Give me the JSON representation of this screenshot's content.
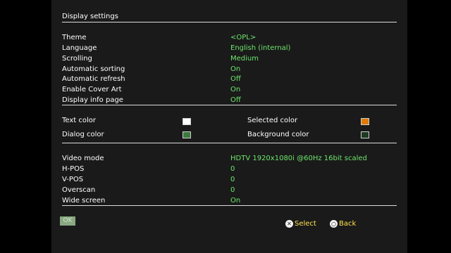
{
  "title": "Display settings",
  "general": {
    "items": [
      {
        "label": "Theme",
        "value": "<OPL>"
      },
      {
        "label": "Language",
        "value": "English (internal)"
      },
      {
        "label": "Scrolling",
        "value": "Medium"
      },
      {
        "label": "Automatic sorting",
        "value": "On"
      },
      {
        "label": "Automatic refresh",
        "value": "Off"
      },
      {
        "label": "Enable Cover Art",
        "value": "On"
      },
      {
        "label": "Display info page",
        "value": "Off"
      }
    ]
  },
  "colors": {
    "text_color": {
      "label": "Text color",
      "color": "#ffffff"
    },
    "dialog_color": {
      "label": "Dialog color",
      "color": "#3c7a3c"
    },
    "selected_color": {
      "label": "Selected color",
      "color": "#e07a00"
    },
    "background_color": {
      "label": "Background color",
      "color": "#1e3a22"
    }
  },
  "video": {
    "items": [
      {
        "label": "Video mode",
        "value": "HDTV 1920x1080i @60Hz 16bit scaled"
      },
      {
        "label": "H-POS",
        "value": "0"
      },
      {
        "label": "V-POS",
        "value": "0"
      },
      {
        "label": "Overscan",
        "value": "0"
      },
      {
        "label": "Wide screen",
        "value": "On"
      }
    ]
  },
  "footer": {
    "ok_label": "OK",
    "select_label": "Select",
    "back_label": "Back",
    "select_icon": "cross-button-icon",
    "back_icon": "circle-button-icon"
  }
}
